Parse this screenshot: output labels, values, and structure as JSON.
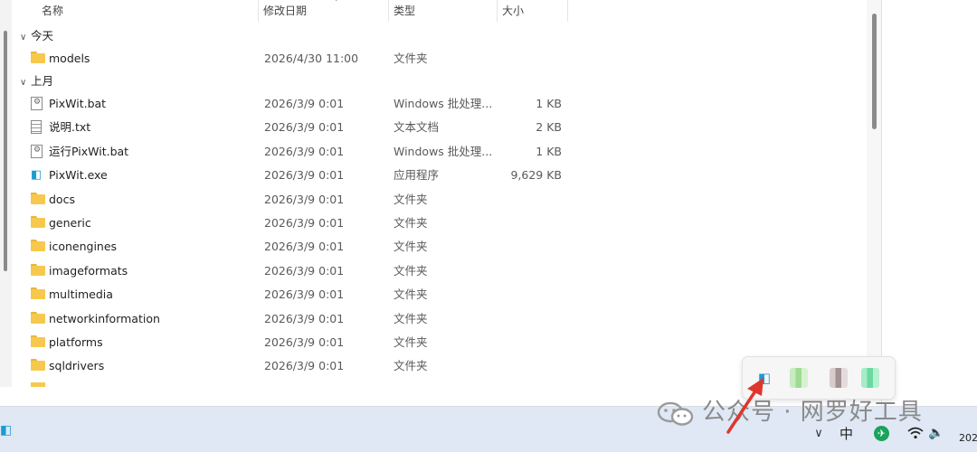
{
  "columns": {
    "name": "名称",
    "date": "修改日期",
    "type": "类型",
    "size": "大小"
  },
  "groups": {
    "today": "今天",
    "last_month": "上月"
  },
  "files": [
    {
      "name": "models",
      "date": "2026/4/30 11:00",
      "type": "文件夹",
      "size": "",
      "icon": "folder-icon"
    },
    {
      "name": "PixWit.bat",
      "date": "2026/3/9 0:01",
      "type": "Windows 批处理...",
      "size": "1 KB",
      "icon": "batch-file-icon"
    },
    {
      "name": "说明.txt",
      "date": "2026/3/9 0:01",
      "type": "文本文档",
      "size": "2 KB",
      "icon": "text-file-icon"
    },
    {
      "name": "运行PixWit.bat",
      "date": "2026/3/9 0:01",
      "type": "Windows 批处理...",
      "size": "1 KB",
      "icon": "batch-file-icon"
    },
    {
      "name": "PixWit.exe",
      "date": "2026/3/9 0:01",
      "type": "应用程序",
      "size": "9,629 KB",
      "icon": "pixwit-app-icon"
    },
    {
      "name": "docs",
      "date": "2026/3/9 0:01",
      "type": "文件夹",
      "size": "",
      "icon": "folder-icon"
    },
    {
      "name": "generic",
      "date": "2026/3/9 0:01",
      "type": "文件夹",
      "size": "",
      "icon": "folder-icon"
    },
    {
      "name": "iconengines",
      "date": "2026/3/9 0:01",
      "type": "文件夹",
      "size": "",
      "icon": "folder-icon"
    },
    {
      "name": "imageformats",
      "date": "2026/3/9 0:01",
      "type": "文件夹",
      "size": "",
      "icon": "folder-icon"
    },
    {
      "name": "multimedia",
      "date": "2026/3/9 0:01",
      "type": "文件夹",
      "size": "",
      "icon": "folder-icon"
    },
    {
      "name": "networkinformation",
      "date": "2026/3/9 0:01",
      "type": "文件夹",
      "size": "",
      "icon": "folder-icon"
    },
    {
      "name": "platforms",
      "date": "2026/3/9 0:01",
      "type": "文件夹",
      "size": "",
      "icon": "folder-icon"
    },
    {
      "name": "sqldrivers",
      "date": "2026/3/9 0:01",
      "type": "文件夹",
      "size": "",
      "icon": "folder-icon"
    }
  ],
  "taskbar": {
    "ime": "中",
    "clock_partial": "202"
  },
  "watermark": {
    "text": "公众号 · 网罗好工具"
  },
  "colors": {
    "taskbar_bg": "#dfe8f4",
    "folder": "#f6c94e",
    "pixwit_accent": "#1d9bd1",
    "arrow": "#e0352b"
  }
}
